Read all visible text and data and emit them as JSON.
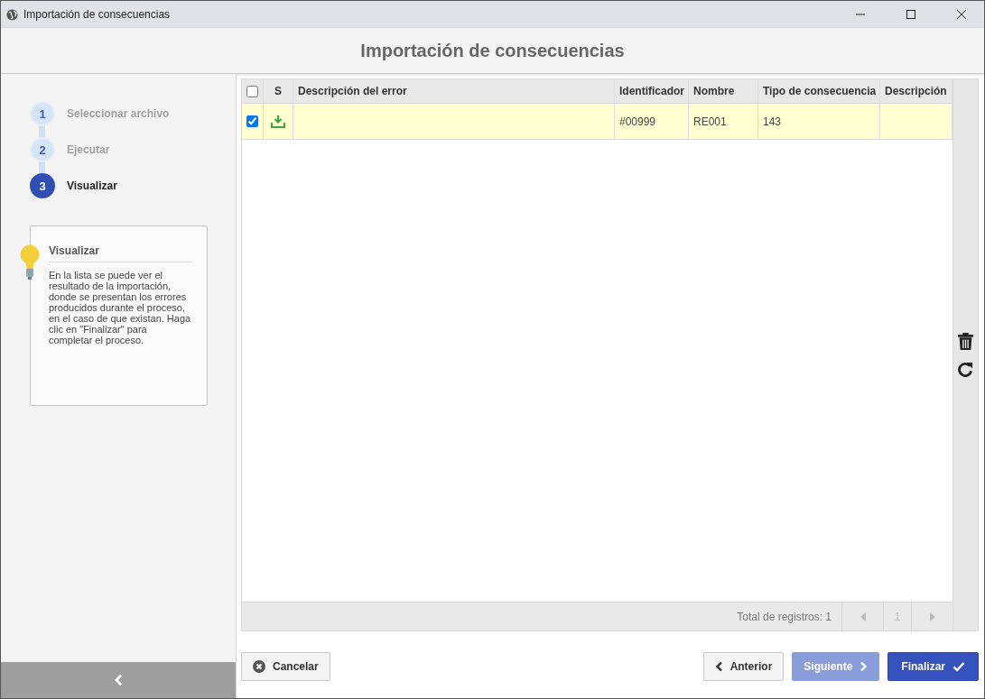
{
  "window": {
    "title": "Importación de consecuencias"
  },
  "header": {
    "title": "Importación de consecuencias"
  },
  "steps": [
    {
      "number": "1",
      "label": "Seleccionar archivo",
      "selected": false
    },
    {
      "number": "2",
      "label": "Ejecutar",
      "selected": false
    },
    {
      "number": "3",
      "label": "Visualizar",
      "selected": true
    }
  ],
  "help": {
    "title": "Visualizar",
    "text": "En la lista se puede ver el resultado de la importación, donde se presentan los errores producidos durante el proceso, en el caso de que existan. Haga clic en \"Finalizar\" para completar el proceso."
  },
  "table": {
    "select_all_checked": false,
    "columns": [
      "S",
      "Descripción del error",
      "Identificador",
      "Nombre",
      "Tipo de consecuencia",
      "Descripción"
    ],
    "rows": [
      {
        "checked": true,
        "cells": [
          "",
          "",
          "#00999",
          "RE001",
          "143",
          ""
        ]
      }
    ],
    "total": "Total de registros: 1",
    "page": "1"
  },
  "buttons": {
    "cancel": "Cancelar",
    "previous": "Anterior",
    "next": "Siguiente",
    "finish": "Finalizar"
  }
}
